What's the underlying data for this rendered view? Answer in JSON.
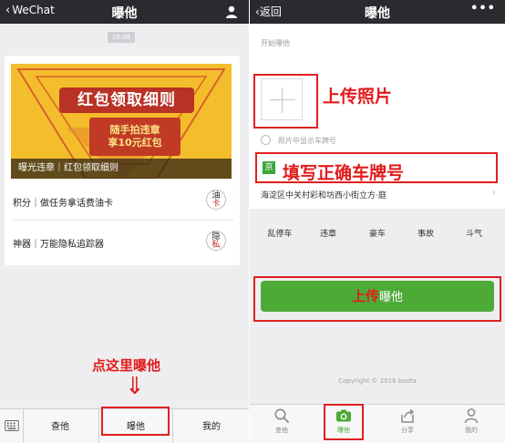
{
  "left": {
    "back_label": "WeChat",
    "title": "曝他",
    "timestamp": "16:08",
    "banner": {
      "headline": "红包领取细则",
      "sub_line1": "随手拍违章",
      "sub_line2": "享10元红包",
      "caption": "曝光违章｜红包领取细则"
    },
    "list": [
      {
        "label": "积分｜做任务拿话费油卡",
        "stamp_top": "油",
        "stamp_bottom": "卡"
      },
      {
        "label": "神器｜万能隐私追踪器",
        "stamp_top": "隐",
        "stamp_bottom": "私"
      }
    ],
    "annotation": "点这里曝他",
    "arrow": "⇓",
    "menu": [
      "查他",
      "曝他",
      "我的"
    ]
  },
  "right": {
    "back_label": "返回",
    "title": "曝他",
    "more": "•••",
    "section_label": "开始曝他",
    "upload_photo_annotation": "上传照片",
    "radio_label": "照片中显示车牌号",
    "plate_prefix": "京",
    "plate_annotation": "填写正确车牌号",
    "address": "海淀区中关村彩和坊西小街立方·庭",
    "categories": [
      "乱停车",
      "违章",
      "豪车",
      "事故",
      "斗气"
    ],
    "upload_button": {
      "highlight": "上传",
      "rest": "曝他"
    },
    "copyright": "Copyright © 2016 baota",
    "tabs": [
      "查他",
      "曝他",
      "分享",
      "我的"
    ]
  },
  "colors": {
    "accent_red": "#e21b1b",
    "brand_green": "#4eaa37",
    "nav_dark": "#2a2b2f"
  }
}
